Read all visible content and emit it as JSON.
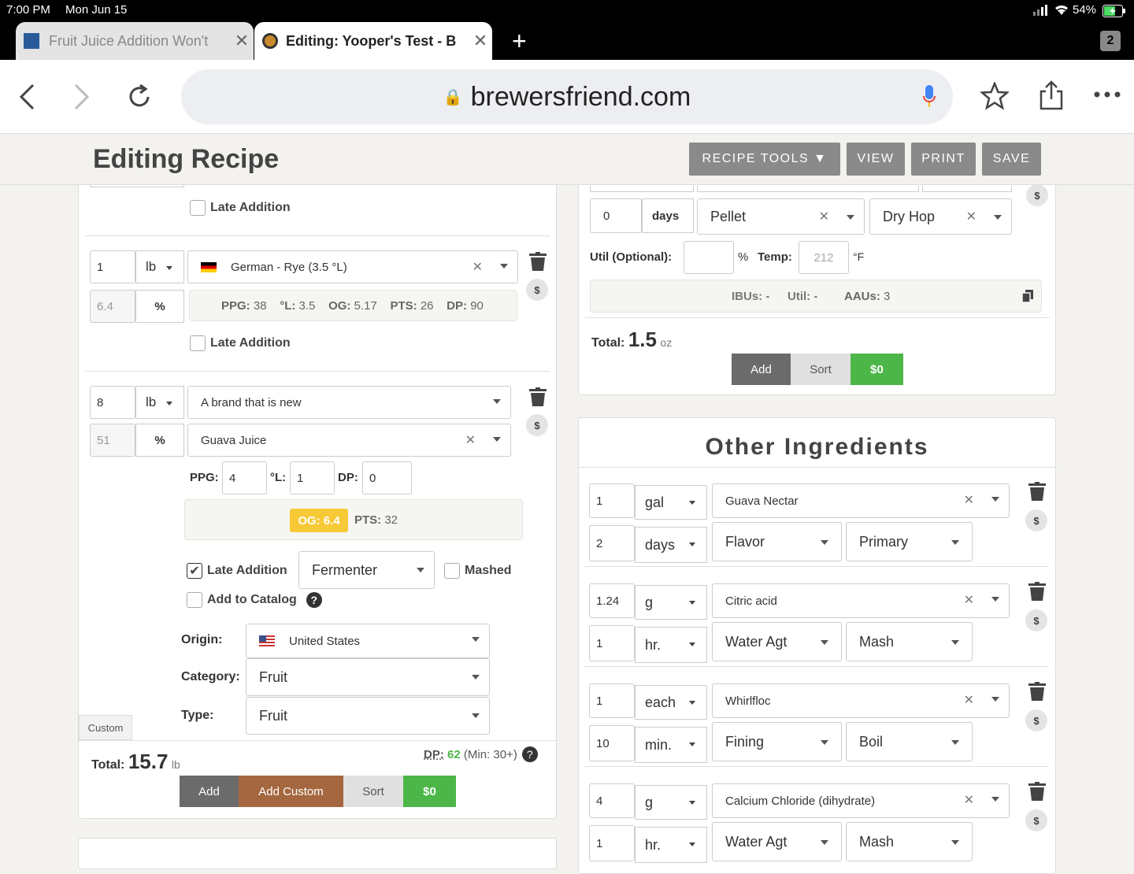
{
  "status": {
    "time": "7:00 PM",
    "date": "Mon Jun 15",
    "battery": "54%"
  },
  "browser": {
    "tabs": [
      {
        "title": "Fruit Juice Addition Won't",
        "active": false
      },
      {
        "title": "Editing: Yooper's Test - B",
        "active": true
      }
    ],
    "tab_count": "2",
    "url": "brewersfriend.com"
  },
  "header": {
    "title": "Editing Recipe",
    "buttons": [
      "RECIPE TOOLS ▼",
      "VIEW",
      "PRINT",
      "SAVE"
    ]
  },
  "fermentables": {
    "late_addition_label": "Late Addition",
    "item1": {
      "amount": "1",
      "unit": "lb",
      "name": "German - Rye (3.5 °L)",
      "percent": "6.4",
      "percent_label": "%",
      "stats": {
        "ppg_label": "PPG:",
        "ppg": "38",
        "l_label": "°L:",
        "l": "3.5",
        "og_label": "OG:",
        "og": "5.17",
        "pts_label": "PTS:",
        "pts": "26",
        "dp_label": "DP:",
        "dp": "90"
      }
    },
    "item2": {
      "amount": "8",
      "unit": "lb",
      "brand": "A brand that is new",
      "name": "Guava Juice",
      "percent": "51",
      "percent_label": "%",
      "ppg_label": "PPG:",
      "ppg": "4",
      "l_label": "°L:",
      "l": "1",
      "dp_label": "DP:",
      "dp": "0",
      "og": "OG: 6.4",
      "pts_label": "PTS:",
      "pts": "32",
      "late_addition": "Late Addition",
      "fermenter": "Fermenter",
      "mashed": "Mashed",
      "add_to_catalog": "Add to Catalog",
      "origin_label": "Origin:",
      "origin": "United States",
      "category_label": "Category:",
      "category": "Fruit",
      "type_label": "Type:",
      "type": "Fruit",
      "custom_tag": "Custom"
    },
    "total_label": "Total:",
    "total": "15.7",
    "total_unit": "lb",
    "dp_label": "DP:",
    "dp": "62",
    "dp_min": "(Min: 30+)",
    "buttons": {
      "add": "Add",
      "add_custom": "Add Custom",
      "sort": "Sort",
      "cost": "$0"
    }
  },
  "hops": {
    "time": "0",
    "time_unit": "days",
    "form": "Pellet",
    "use": "Dry Hop",
    "util_label": "Util (Optional):",
    "util_pct": "%",
    "temp_label": "Temp:",
    "temp_placeholder": "212",
    "temp_unit": "°F",
    "ibus": "IBUs: -",
    "util": "Util: -",
    "aaus_label": "AAUs:",
    "aaus": "3",
    "total_label": "Total:",
    "total": "1.5",
    "total_unit": "oz",
    "buttons": {
      "add": "Add",
      "sort": "Sort",
      "cost": "$0"
    }
  },
  "other": {
    "title": "Other Ingredients",
    "items": [
      {
        "amount": "1",
        "unit": "gal",
        "name": "Guava Nectar",
        "time": "2",
        "time_unit": "days",
        "use": "Flavor",
        "stage": "Primary"
      },
      {
        "amount": "1.24",
        "unit": "g",
        "name": "Citric acid",
        "time": "1",
        "time_unit": "hr.",
        "use": "Water Agt",
        "stage": "Mash"
      },
      {
        "amount": "1",
        "unit": "each",
        "name": "Whirlfloc",
        "time": "10",
        "time_unit": "min.",
        "use": "Fining",
        "stage": "Boil"
      },
      {
        "amount": "4",
        "unit": "g",
        "name": "Calcium Chloride (dihydrate)",
        "time": "1",
        "time_unit": "hr.",
        "use": "Water Agt",
        "stage": "Mash"
      }
    ]
  },
  "colors": {
    "add": "#6b6b6b",
    "add_custom": "#a5673f",
    "sort": "#e0e0e0",
    "cost": "#4cb648",
    "og_badge": "#f7c936"
  }
}
